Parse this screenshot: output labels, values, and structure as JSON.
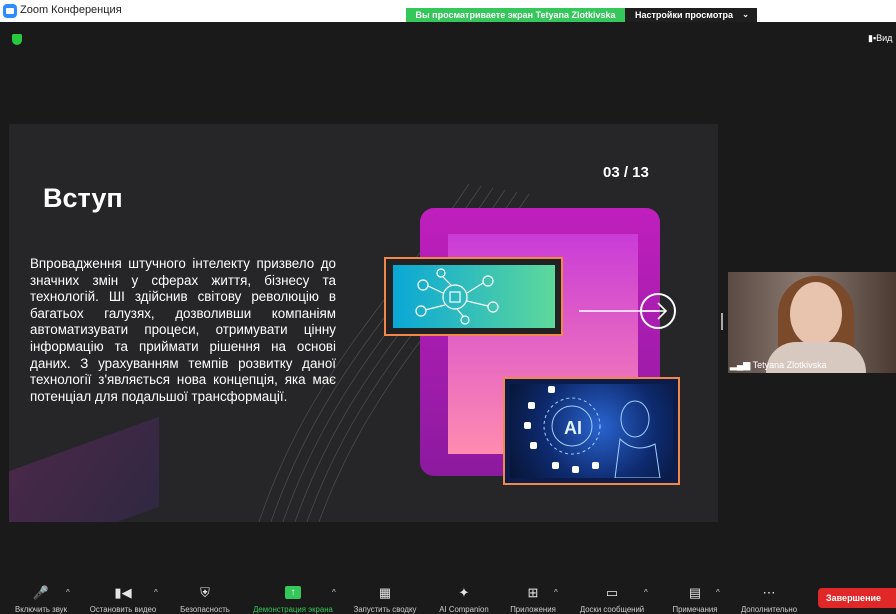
{
  "window": {
    "title": "Zoom Конференция"
  },
  "share": {
    "banner": "Вы просматриваете экран Tetyana Zlotkivska",
    "view_options": "Настройки просмотра"
  },
  "top_right": {
    "view": "Вид"
  },
  "slide": {
    "title": "Вступ",
    "page": "03 / 13",
    "body": "Впровадження штучного інтелекту призвело до значних змін у сферах життя, бізнесу та технологій. ШІ здійснив світову революцію в багатьох галузях, дозволивши компаніям автоматизувати процеси, отримувати цінну інформацію та приймати рішення на основі даних. З урахуванням темпів розвитку даної технології з'являється нова концепція, яка має потенціал для подальшої трансформації.",
    "ai_label": "AI"
  },
  "participant": {
    "name": "Tetyana Zlotkivska"
  },
  "toolbar": {
    "unmute": "Включить звук",
    "stop_video": "Остановить видео",
    "security": "Безопасность",
    "share_screen": "Демонстрация экрана",
    "summary": "Запустить сводку",
    "ai_companion": "AI Companion",
    "apps": "Приложения",
    "whiteboards": "Доски сообщений",
    "notes": "Примечания",
    "more": "Дополнительно",
    "end": "Завершение"
  },
  "colors": {
    "share_green": "#34c759",
    "end_red": "#e02828",
    "accent_orange": "#f2874a",
    "slide_magenta": "#c01fbd"
  }
}
